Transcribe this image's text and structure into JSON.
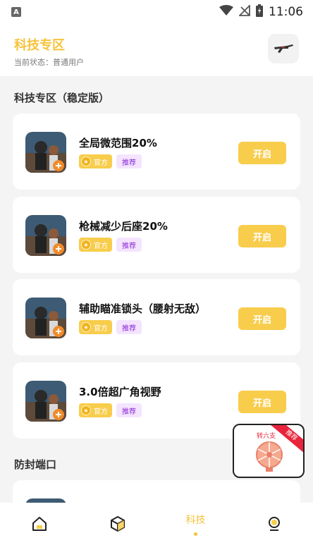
{
  "status_bar": {
    "time": "11:06"
  },
  "header": {
    "title": "科技专区",
    "status": "当前状态：普通用户"
  },
  "sections": [
    {
      "title": "科技专区（稳定版）"
    },
    {
      "title": "防封端口"
    }
  ],
  "cards": [
    {
      "name": "全局微范围20%",
      "tag_official": "官方",
      "tag_rec": "推荐",
      "button": "开启"
    },
    {
      "name": "枪械减少后座20%",
      "tag_official": "官方",
      "tag_rec": "推荐",
      "button": "开启"
    },
    {
      "name": "辅助瞄准锁头（腰射无敌）",
      "tag_official": "官方",
      "tag_rec": "推荐",
      "button": "开启"
    },
    {
      "name": "3.0倍超广角视野",
      "tag_official": "官方",
      "tag_rec": "推荐",
      "button": "开启"
    }
  ],
  "promo": {
    "label": "转六支",
    "ribbon": "推荐"
  },
  "bottom_nav": {
    "active_label": "科技"
  },
  "colors": {
    "accent": "#f8cd4c",
    "title": "#f5c33b",
    "tag_rec_bg": "#f4e4ff",
    "ribbon": "#e8243c"
  }
}
